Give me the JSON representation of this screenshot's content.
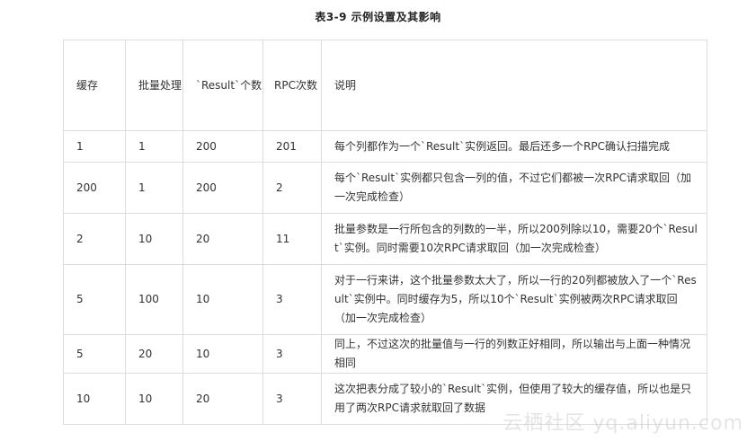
{
  "caption": "表3-9    示例设置及其影响",
  "headers": [
    "缓存",
    "批量处理",
    "`Result`个数",
    "RPC次数",
    "说明"
  ],
  "rows": [
    [
      "1",
      "1",
      "200",
      "201",
      "每个列都作为一个`Result`实例返回。最后还多一个RPC确认扫描完成"
    ],
    [
      "200",
      "1",
      "200",
      "2",
      "每个`Result`实例都只包含一列的值，不过它们都被一次RPC请求取回（加一次完成检查）"
    ],
    [
      "2",
      "10",
      "20",
      "11",
      "批量参数是一行所包含的列数的一半，所以200列除以10，需要20个`Result`实例。同时需要10次RPC请求取回（加一次完成检查）"
    ],
    [
      "5",
      "100",
      "10",
      "3",
      "对于一行来讲，这个批量参数太大了，所以一行的20列都被放入了一个`Result`实例中。同时缓存为5，所以10个`Result`实例被两次RPC请求取回（加一次完成检查）"
    ],
    [
      "5",
      "20",
      "10",
      "3",
      "同上，不过这次的批量值与一行的列数正好相同，所以输出与上面一种情况相同"
    ],
    [
      "10",
      "10",
      "20",
      "3",
      "这次把表分成了较小的`Result`实例，但使用了较大的缓存值，所以也是只用了两次RPC请求就取回了数据"
    ]
  ],
  "watermark": "云栖社区 yq.aliyun.com"
}
